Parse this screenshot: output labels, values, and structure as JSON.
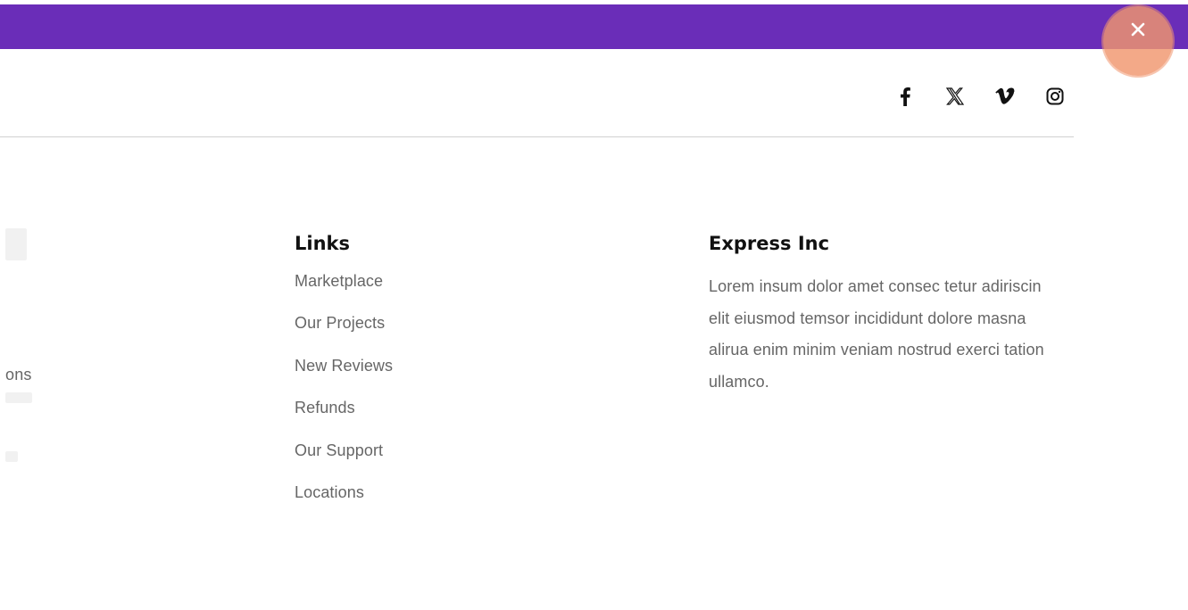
{
  "header": {
    "bar_color": "#6a2db8",
    "close_icon": "close-icon",
    "close_button_color": "#f0966e"
  },
  "social": {
    "items": [
      {
        "name": "facebook",
        "icon": "facebook-icon",
        "glyph": "f"
      },
      {
        "name": "x",
        "icon": "x-icon",
        "glyph": "𝕏"
      },
      {
        "name": "vimeo",
        "icon": "vimeo-icon",
        "glyph": "v"
      },
      {
        "name": "instagram",
        "icon": "instagram-icon",
        "glyph": ""
      }
    ]
  },
  "left_column": {
    "fragment_text": "ons"
  },
  "links": {
    "heading": "Links",
    "items": [
      {
        "label": "Marketplace"
      },
      {
        "label": "Our Projects"
      },
      {
        "label": "New Reviews"
      },
      {
        "label": "Refunds"
      },
      {
        "label": "Our Support"
      },
      {
        "label": "Locations"
      }
    ]
  },
  "express": {
    "heading": "Express Inc",
    "text": "Lorem insum dolor amet consec tetur adiriscin elit eiusmod temsor incididunt dolore masna alirua enim minim veniam nostrud exerci tation ullamco."
  }
}
